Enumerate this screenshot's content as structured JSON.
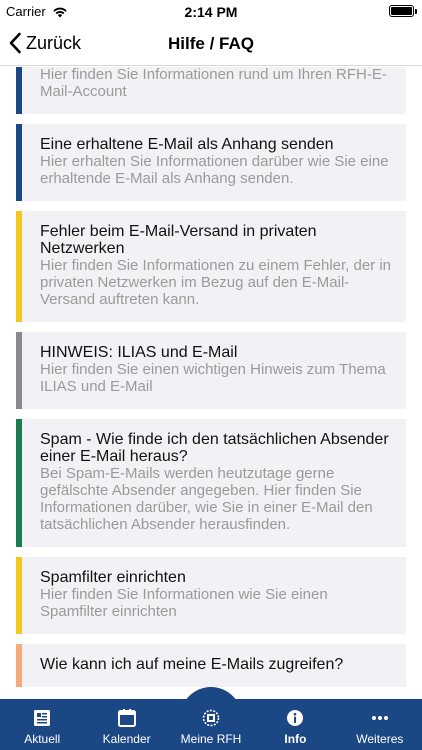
{
  "status_bar": {
    "carrier": "Carrier",
    "time": "2:14 PM"
  },
  "nav": {
    "back_label": "Zurück",
    "title": "Hilfe / FAQ"
  },
  "faq": [
    {
      "title": "",
      "description": "Hier finden Sie Informationen rund um Ihren RFH-E-Mail-Account",
      "color": "#1b4784"
    },
    {
      "title": "Eine erhaltene E-Mail als Anhang senden",
      "description": "Hier erhalten Sie Informationen darüber wie Sie eine erhaltende E-Mail als Anhang senden.",
      "color": "#1b4784"
    },
    {
      "title": "Fehler beim E-Mail-Versand in privaten Netzwerken",
      "description": "Hier finden Sie Informationen zu einem Fehler, der in privaten Netzwerken im Bezug auf den E-Mail-Versand auftreten kann.",
      "color": "#f2c81c"
    },
    {
      "title": "HINWEIS: ILIAS und E-Mail",
      "description": "Hier finden Sie einen wichtigen Hinweis zum Thema ILIAS und E-Mail",
      "color": "#8a8a8a"
    },
    {
      "title": "Spam - Wie finde ich den tatsächlichen Absender einer E-Mail heraus?",
      "description": "Bei Spam-E-Mails werden heutzutage gerne gefälschte Absender angegeben. Hier finden Sie Informationen darüber, wie Sie in einer E-Mail den tatsächlichen Absender herausfinden.",
      "color": "#1c7a4f"
    },
    {
      "title": "Spamfilter einrichten",
      "description": "Hier finden Sie Informationen wie Sie einen Spamfilter einrichten",
      "color": "#f2c81c"
    },
    {
      "title": "Wie kann ich auf meine E-Mails zugreifen?",
      "description": "",
      "color": "#f6a97a"
    }
  ],
  "tabs": [
    {
      "label": "Aktuell",
      "icon": "newspaper-icon"
    },
    {
      "label": "Kalender",
      "icon": "calendar-icon"
    },
    {
      "label": "Meine RFH",
      "icon": "rfh-logo-icon"
    },
    {
      "label": "Info",
      "icon": "info-icon",
      "active": true
    },
    {
      "label": "Weiteres",
      "icon": "more-dots-icon"
    }
  ],
  "colors": {
    "brand": "#1b4784",
    "card_bg": "#f2f2f6",
    "description_text": "#9a9a9a"
  }
}
